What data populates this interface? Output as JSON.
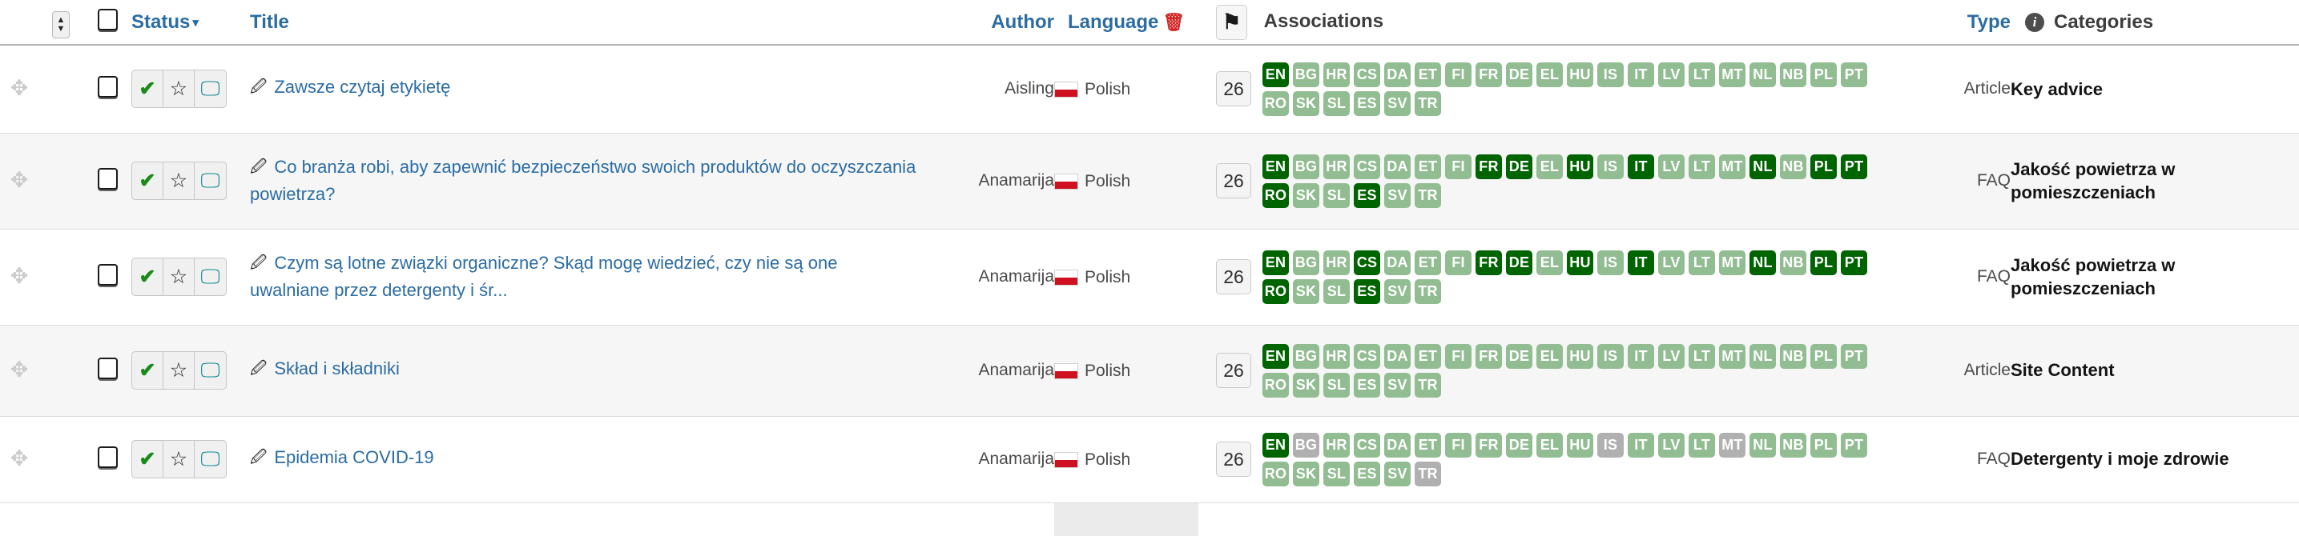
{
  "header": {
    "info_icon_top": "info-icon",
    "sort_control": "sort-toggle",
    "select_all": "select-all-checkbox",
    "columns": {
      "status": "Status",
      "status_caret": "▾",
      "title": "Title",
      "author": "Author",
      "language": "Language",
      "language_trash": "trash-icon",
      "flag_button": "⚑",
      "associations": "Associations",
      "type": "Type",
      "type_info": "info-icon",
      "categories": "Categories"
    }
  },
  "language_codes_row1": [
    "EN",
    "BG",
    "HR",
    "CS",
    "DA",
    "ET",
    "FI",
    "FR",
    "DE",
    "EL",
    "HU",
    "IS",
    "IT",
    "LV",
    "LT"
  ],
  "language_codes_row2": [
    "MT",
    "NL",
    "NB",
    "PL",
    "PT",
    "RO",
    "SK",
    "SL",
    "ES",
    "SV",
    "TR"
  ],
  "colors": {
    "link": "#2b6ca3",
    "chip_on": "#006400",
    "chip_off": "#92bd92",
    "chip_na": "#b0b0b0",
    "check_green": "#1a8a1a",
    "screen_teal": "#0f8a91",
    "trash_red": "#d32525",
    "lang_column_bg": "#ebebeb"
  },
  "rows": [
    {
      "drag": "⤧",
      "status": {
        "approved": "✔",
        "star": "☆",
        "screen": "🖵"
      },
      "edit": "✎",
      "title": "Zawsze czytaj etykietę",
      "author": "Aisling",
      "language": "Polish",
      "assoc_count": "26",
      "chips": {
        "EN": "on",
        "BG": "off",
        "HR": "off",
        "CS": "off",
        "DA": "off",
        "ET": "off",
        "FI": "off",
        "FR": "off",
        "DE": "off",
        "EL": "off",
        "HU": "off",
        "IS": "off",
        "IT": "off",
        "LV": "off",
        "LT": "off",
        "MT": "off",
        "NL": "off",
        "NB": "off",
        "PL": "off",
        "PT": "off",
        "RO": "off",
        "SK": "off",
        "SL": "off",
        "ES": "off",
        "SV": "off",
        "TR": "off"
      },
      "type": "Article",
      "category": "Key advice"
    },
    {
      "drag": "⤧",
      "status": {
        "approved": "✔",
        "star": "☆",
        "screen": "🖵"
      },
      "edit": "✎",
      "title": "Co branża robi, aby zapewnić bezpieczeństwo swoich produktów do oczyszczania powietrza?",
      "author": "Anamarija",
      "language": "Polish",
      "assoc_count": "26",
      "chips": {
        "EN": "on",
        "BG": "off",
        "HR": "off",
        "CS": "off",
        "DA": "off",
        "ET": "off",
        "FI": "off",
        "FR": "on",
        "DE": "on",
        "EL": "off",
        "HU": "on",
        "IS": "off",
        "IT": "on",
        "LV": "off",
        "LT": "off",
        "MT": "off",
        "NL": "on",
        "NB": "off",
        "PL": "on",
        "PT": "on",
        "RO": "on",
        "SK": "off",
        "SL": "off",
        "ES": "on",
        "SV": "off",
        "TR": "off"
      },
      "type": "FAQ",
      "category": "Jakość powietrza w pomieszczeniach"
    },
    {
      "drag": "⤧",
      "status": {
        "approved": "✔",
        "star": "☆",
        "screen": "🖵"
      },
      "edit": "✎",
      "title": "Czym są lotne związki organiczne? Skąd mogę wiedzieć, czy nie są one uwalniane przez detergenty i śr...",
      "author": "Anamarija",
      "language": "Polish",
      "assoc_count": "26",
      "chips": {
        "EN": "on",
        "BG": "off",
        "HR": "off",
        "CS": "on",
        "DA": "off",
        "ET": "off",
        "FI": "off",
        "FR": "on",
        "DE": "on",
        "EL": "off",
        "HU": "on",
        "IS": "off",
        "IT": "on",
        "LV": "off",
        "LT": "off",
        "MT": "off",
        "NL": "on",
        "NB": "off",
        "PL": "on",
        "PT": "on",
        "RO": "on",
        "SK": "off",
        "SL": "off",
        "ES": "on",
        "SV": "off",
        "TR": "off"
      },
      "type": "FAQ",
      "category": "Jakość powietrza w pomieszczeniach"
    },
    {
      "drag": "⤧",
      "status": {
        "approved": "✔",
        "star": "☆",
        "screen": "🖵"
      },
      "edit": "✎",
      "title": "Skład i składniki",
      "author": "Anamarija",
      "language": "Polish",
      "assoc_count": "26",
      "chips": {
        "EN": "on",
        "BG": "off",
        "HR": "off",
        "CS": "off",
        "DA": "off",
        "ET": "off",
        "FI": "off",
        "FR": "off",
        "DE": "off",
        "EL": "off",
        "HU": "off",
        "IS": "off",
        "IT": "off",
        "LV": "off",
        "LT": "off",
        "MT": "off",
        "NL": "off",
        "NB": "off",
        "PL": "off",
        "PT": "off",
        "RO": "off",
        "SK": "off",
        "SL": "off",
        "ES": "off",
        "SV": "off",
        "TR": "off"
      },
      "type": "Article",
      "category": "Site Content"
    },
    {
      "drag": "⤧",
      "status": {
        "approved": "✔",
        "star": "☆",
        "screen": "🖵"
      },
      "edit": "✎",
      "title": "Epidemia COVID-19",
      "author": "Anamarija",
      "language": "Polish",
      "assoc_count": "26",
      "chips": {
        "EN": "on",
        "BG": "na",
        "HR": "off",
        "CS": "off",
        "DA": "off",
        "ET": "off",
        "FI": "off",
        "FR": "off",
        "DE": "off",
        "EL": "off",
        "HU": "off",
        "IS": "na",
        "IT": "off",
        "LV": "off",
        "LT": "off",
        "MT": "na",
        "NL": "off",
        "NB": "off",
        "PL": "off",
        "PT": "off",
        "RO": "off",
        "SK": "off",
        "SL": "off",
        "ES": "off",
        "SV": "off",
        "TR": "na"
      },
      "type": "FAQ",
      "category": "Detergenty i moje zdrowie"
    }
  ]
}
